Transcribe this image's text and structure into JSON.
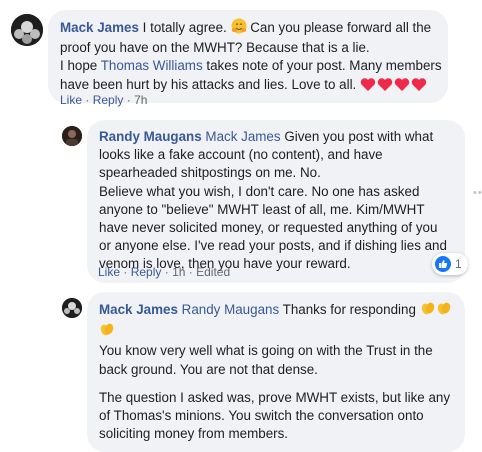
{
  "comments": [
    {
      "author": "Mack James",
      "text_line1_a": "I totally agree.",
      "text_line1_b": "Can you please forward all the",
      "text_line2": "proof you have on the MWHT? Because that is a lie.",
      "text_line3_a": "I hope",
      "tag": "Thomas Williams",
      "text_line3_b": "takes note of your post. Many members",
      "text_line4": "have been hurt by his attacks and lies. Love to all.",
      "actions": {
        "like": "Like",
        "reply": "Reply",
        "time": "7h"
      }
    },
    {
      "author": "Randy Maugans",
      "tag": "Mack James",
      "lines": [
        "Given you post with what",
        "looks like a fake account (no content), and have",
        "spearheaded shitpostings on me. No.",
        "Believe what you wish, I don't care. No one has asked",
        "anyone to \"believe\" MWHT least of all, me. Kim/MWHT",
        "have never solicited money, or requested anything of you",
        "or anyone else. I've read your posts, and if dishing lies and",
        "venom is love, then you have your reward."
      ],
      "reaction_count": "1",
      "actions": {
        "like": "Like",
        "reply": "Reply",
        "time": "1h",
        "edited": "Edited"
      }
    },
    {
      "author": "Mack James",
      "tag": "Randy Maugans",
      "first": "Thanks for responding",
      "para1": [
        "You know very well what is going on with the Trust in the",
        "back ground. You are not that dense."
      ],
      "para2": [
        "The question I asked was, prove MWHT exists, but like any",
        "of Thomas's minions. You switch the conversation onto",
        "soliciting money from members."
      ]
    }
  ],
  "separator": "·",
  "more_dots": "••",
  "colors": {
    "link": "#385898",
    "bubble": "#f0f2f5",
    "like_blue": "#1877f2",
    "heart": "#f0284a"
  }
}
